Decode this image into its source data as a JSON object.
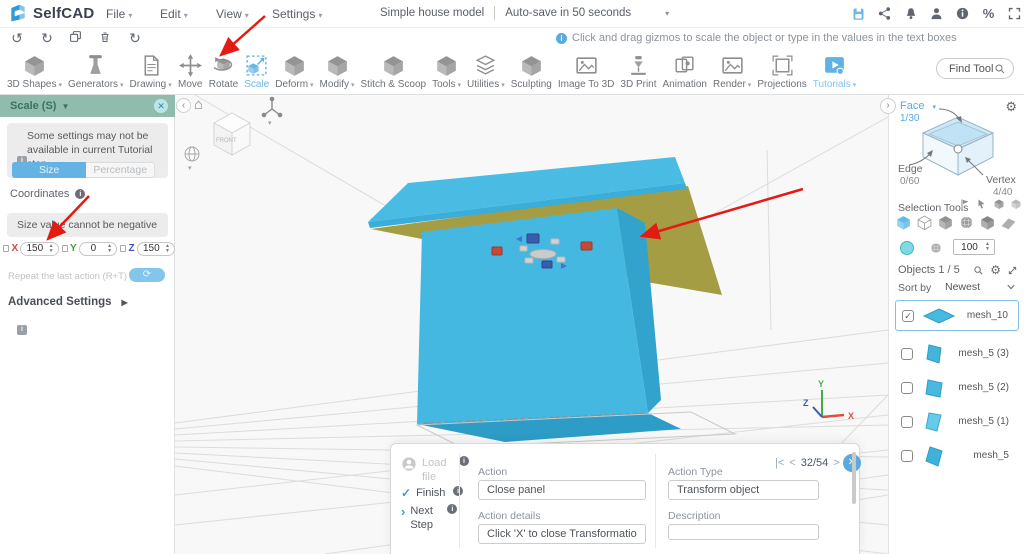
{
  "menubar": {
    "logo_text": "SelfCAD",
    "menus": [
      {
        "label": "File"
      },
      {
        "label": "Edit"
      },
      {
        "label": "View"
      },
      {
        "label": "Settings"
      }
    ],
    "doc_title": "Simple house model",
    "autosave": "Auto-save in 50 seconds"
  },
  "quickbar": {
    "hint": "Click and drag gizmos to scale the object or type in the values in the text boxes"
  },
  "toolbar": {
    "items": [
      {
        "label": "3D Shapes"
      },
      {
        "label": "Generators"
      },
      {
        "label": "Drawing"
      },
      {
        "label": "Move"
      },
      {
        "label": "Rotate"
      },
      {
        "label": "Scale"
      },
      {
        "label": "Deform"
      },
      {
        "label": "Modify"
      },
      {
        "label": "Stitch & Scoop"
      },
      {
        "label": "Tools"
      },
      {
        "label": "Utilities"
      },
      {
        "label": "Sculpting"
      },
      {
        "label": "Image To 3D"
      },
      {
        "label": "3D Print"
      },
      {
        "label": "Animation"
      },
      {
        "label": "Render"
      },
      {
        "label": "Projections"
      },
      {
        "label": "Tutorials"
      }
    ],
    "find_tool": "Find Tool"
  },
  "left_panel": {
    "title": "Scale (S)",
    "notice": "Some settings may not be available in current Tutorial step",
    "tab_size": "Size",
    "tab_percentage": "Percentage",
    "coordinates_label": "Coordinates",
    "warning": "Size value cannot be negative",
    "axes": [
      {
        "label": "X",
        "value": "150"
      },
      {
        "label": "Y",
        "value": "0"
      },
      {
        "label": "Z",
        "value": "150"
      }
    ],
    "repeat_label": "Repeat the last action (R+T)",
    "advanced_label": "Advanced Settings"
  },
  "viewport": {
    "view_cube_label": "FRONT",
    "axis_x": "X",
    "axis_y": "Y",
    "axis_z": "Z"
  },
  "right_panel": {
    "face_label": "Face",
    "face_count": "1/30",
    "edge_label": "Edge",
    "edge_count": "0/60",
    "vertex_label": "Vertex",
    "vertex_count": "4/40",
    "selection_tools_label": "Selection Tools",
    "opacity_value": "100",
    "objects_label": "Objects 1 / 5",
    "sort_label": "Sort by",
    "sort_value": "Newest",
    "objects": [
      {
        "name": "mesh_10",
        "checked": true
      },
      {
        "name": "mesh_5 (3)",
        "checked": false
      },
      {
        "name": "mesh_5 (2)",
        "checked": false
      },
      {
        "name": "mesh_5 (1)",
        "checked": false
      },
      {
        "name": "mesh_5",
        "checked": false
      }
    ]
  },
  "tutorial": {
    "load_file": "Load file",
    "finish": "Finish",
    "next_step": "Next Step",
    "action_label": "Action",
    "action_value": "Close panel",
    "details_label": "Action details",
    "details_value": "Click 'X' to close Transformation panel.",
    "type_label": "Action Type",
    "type_value": "Transform object",
    "description_label": "Description",
    "description_value": "",
    "nav": "32/54",
    "nav_first": "|<",
    "nav_prev": "<",
    "nav_next": ">",
    "nav_last": ">|"
  },
  "colors": {
    "accent_blue": "#58aadf",
    "panel_header_green": "#8fbcac",
    "house_blue": "#45b8e1",
    "roof_olive": "#a59d43",
    "annotation_red": "#e31b12"
  }
}
